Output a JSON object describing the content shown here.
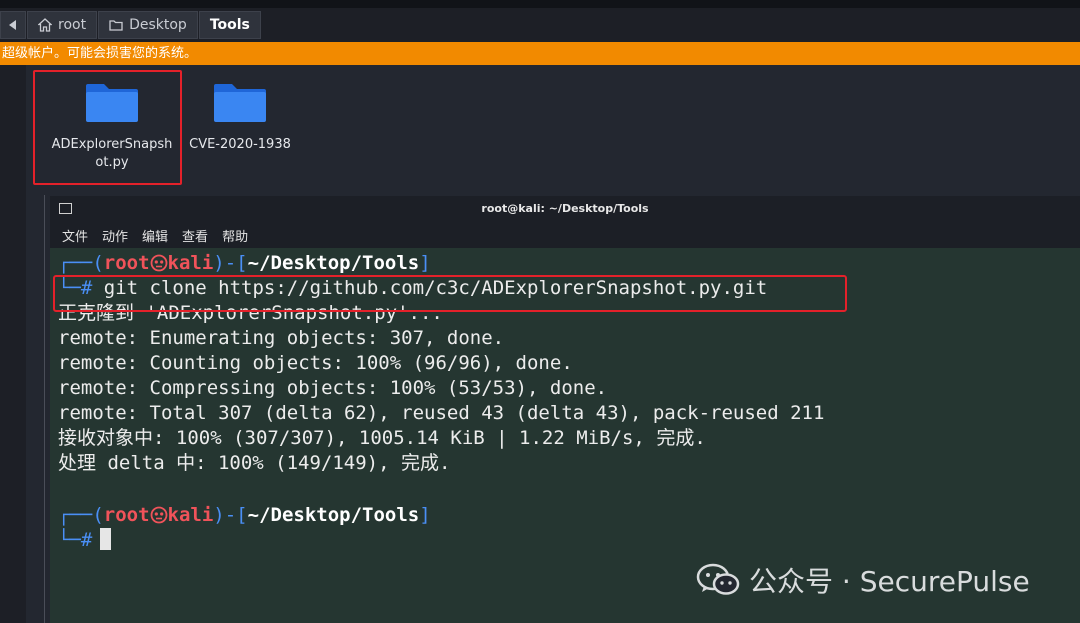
{
  "breadcrumb": {
    "back_icon": "chevron-left-icon",
    "items": [
      {
        "label": "root",
        "icon": "home-icon"
      },
      {
        "label": "Desktop",
        "icon": "folder-icon"
      },
      {
        "label": "Tools"
      }
    ]
  },
  "warning": {
    "text": "超级帐户。可能会损害您的系统。",
    "color": "#f28a00"
  },
  "desktop": {
    "files": [
      {
        "name": "ADExplorerSnapsh\not.py",
        "icon": "folder-icon",
        "selected": true
      },
      {
        "name": "CVE-2020-1938",
        "icon": "folder-icon",
        "selected": false
      }
    ]
  },
  "terminal": {
    "title": "root@kali: ~/Desktop/Tools",
    "menu": [
      "文件",
      "动作",
      "编辑",
      "查看",
      "帮助"
    ],
    "prompt": {
      "open": "┌──(",
      "user": "root",
      "host_icon": "kali-skull-icon",
      "host": "kali",
      "mid": ")-[",
      "path": "~/Desktop/Tools",
      "close": "]",
      "hash": "└─#"
    },
    "command": "git clone https://github.com/c3c/ADExplorerSnapshot.py.git",
    "output": [
      "正克隆到 'ADExplorerSnapshot.py'...",
      "remote: Enumerating objects: 307, done.",
      "remote: Counting objects: 100% (96/96), done.",
      "remote: Compressing objects: 100% (53/53), done.",
      "remote: Total 307 (delta 62), reused 43 (delta 43), pack-reused 211",
      "接收对象中: 100% (307/307), 1005.14 KiB | 1.22 MiB/s, 完成.",
      "处理 delta 中: 100% (149/149), 完成."
    ]
  },
  "watermark": {
    "text": "公众号 · SecurePulse",
    "icon": "wechat-icon"
  },
  "colors": {
    "highlight": "#e4212a",
    "terminal_bg": "#253631",
    "prompt_blue": "#4a8ff5",
    "prompt_red": "#f0535a"
  }
}
